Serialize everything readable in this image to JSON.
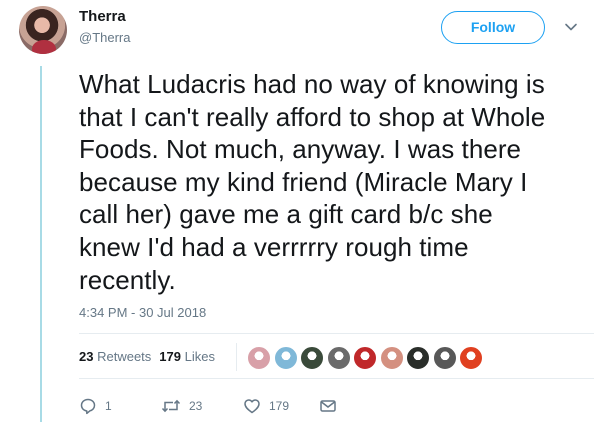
{
  "user": {
    "display_name": "Therra",
    "handle": "@Therra",
    "avatar_icon": "profile-photo"
  },
  "header": {
    "follow_label": "Follow",
    "menu_icon": "chevron-down-icon"
  },
  "tweet": {
    "lines": [
      "What Ludacris had no way of knowing is",
      "that I can't really afford to shop at Whole",
      "Foods. Not much, anyway. I was there",
      "because my kind friend (Miracle Mary I",
      "call her) gave me a gift card b/c she",
      "knew I'd had a verrrrry rough time",
      "recently."
    ],
    "timestamp": "4:34 PM - 30 Jul 2018"
  },
  "stats": {
    "retweets_count": "23",
    "retweets_label": "Retweets",
    "likes_count": "179",
    "likes_label": "Likes"
  },
  "likers": [
    {
      "name": "liker-avatar-1",
      "color": "#d8a0a8"
    },
    {
      "name": "liker-avatar-2",
      "color": "#7fb8d8"
    },
    {
      "name": "liker-avatar-3",
      "color": "#3a4a3a"
    },
    {
      "name": "liker-avatar-4",
      "color": "#6a6a6a"
    },
    {
      "name": "liker-avatar-5",
      "color": "#c0282a"
    },
    {
      "name": "liker-avatar-6",
      "color": "#d49080"
    },
    {
      "name": "liker-avatar-7",
      "color": "#2a2e2a"
    },
    {
      "name": "liker-avatar-8",
      "color": "#585858"
    },
    {
      "name": "liker-avatar-9",
      "color": "#e04020"
    }
  ],
  "actions": {
    "reply_count": "1",
    "retweet_count": "23",
    "like_count": "179"
  },
  "colors": {
    "accent": "#1da1f2",
    "secondary_text": "#657786",
    "thread_line": "#a8dbe6"
  }
}
